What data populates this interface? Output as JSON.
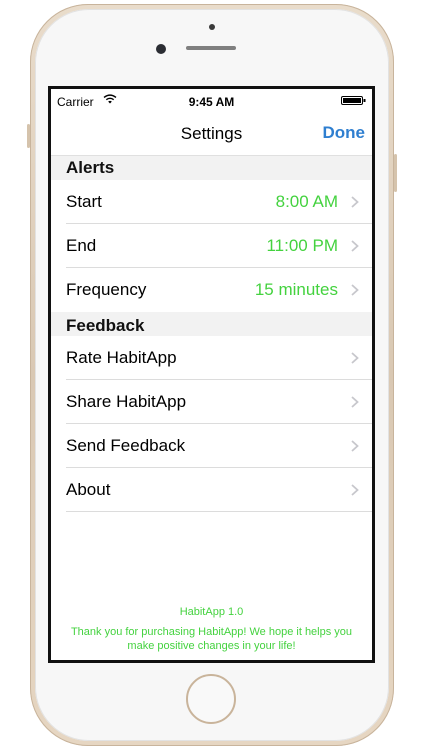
{
  "status_bar": {
    "carrier": "Carrier",
    "time": "9:45 AM"
  },
  "nav": {
    "title": "Settings",
    "done_label": "Done"
  },
  "sections": [
    {
      "header": "Alerts",
      "rows": [
        {
          "label": "Start",
          "value": "8:00 AM"
        },
        {
          "label": "End",
          "value": "11:00 PM"
        },
        {
          "label": "Frequency",
          "value": "15 minutes"
        }
      ]
    },
    {
      "header": "Feedback",
      "rows": [
        {
          "label": "Rate HabitApp"
        },
        {
          "label": "Share HabitApp"
        },
        {
          "label": "Send Feedback"
        },
        {
          "label": "About"
        }
      ]
    }
  ],
  "footer": {
    "version": "HabitApp 1.0",
    "message": "Thank you for purchasing HabitApp! We hope it helps you make positive changes in your life!"
  },
  "colors": {
    "accent_blue": "#2f7fd0",
    "value_green": "#44d23f",
    "device_gold": "#e6d6c2"
  },
  "icons": [
    "wifi-icon",
    "battery-icon",
    "chevron-right-icon"
  ]
}
